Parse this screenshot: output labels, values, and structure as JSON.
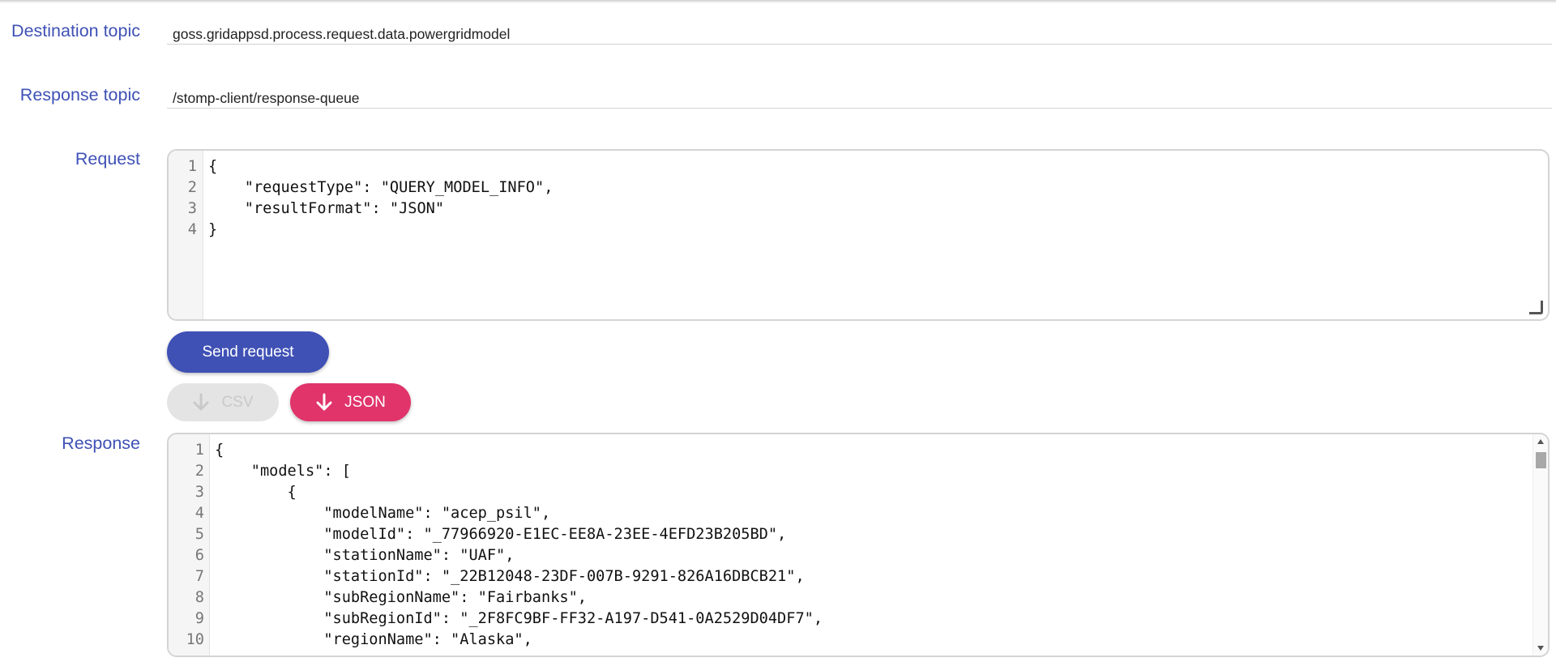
{
  "destination": {
    "label": "Destination topic",
    "value": "goss.gridappsd.process.request.data.powergridmodel"
  },
  "response_topic": {
    "label": "Response topic",
    "value": "/stomp-client/response-queue"
  },
  "request": {
    "label": "Request",
    "line_numbers": [
      "1",
      "2",
      "3",
      "4"
    ],
    "lines": [
      "{",
      "    \"requestType\": \"QUERY_MODEL_INFO\",",
      "    \"resultFormat\": \"JSON\"",
      "}"
    ]
  },
  "buttons": {
    "send_label": "Send request",
    "csv_label": "CSV",
    "json_label": "JSON"
  },
  "response": {
    "label": "Response",
    "line_numbers": [
      "1",
      "2",
      "3",
      "4",
      "5",
      "6",
      "7",
      "8",
      "9",
      "10"
    ],
    "lines": [
      "{",
      "    \"models\": [",
      "        {",
      "            \"modelName\": \"acep_psil\",",
      "            \"modelId\": \"_77966920-E1EC-EE8A-23EE-4EFD23B205BD\",",
      "            \"stationName\": \"UAF\",",
      "            \"stationId\": \"_22B12048-23DF-007B-9291-826A16DBCB21\",",
      "            \"subRegionName\": \"Fairbanks\",",
      "            \"subRegionId\": \"_2F8FC9BF-FF32-A197-D541-0A2529D04DF7\",",
      "            \"regionName\": \"Alaska\","
    ]
  },
  "icons": {
    "download": "arrow-down-icon",
    "resize": "resize-grip-icon"
  },
  "colors": {
    "primary": "#3f51b5",
    "accent": "#e0346a",
    "disabled": "#e4e4e4"
  }
}
